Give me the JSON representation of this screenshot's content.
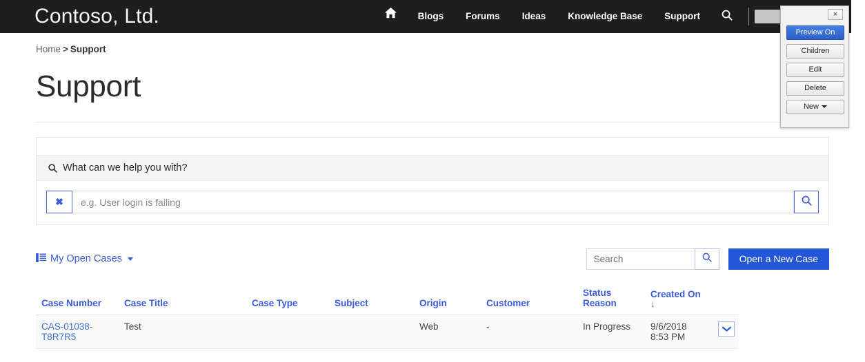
{
  "navbar": {
    "brand": "Contoso, Ltd.",
    "home_icon": "home-icon",
    "links": [
      "Blogs",
      "Forums",
      "Ideas",
      "Knowledge Base",
      "Support"
    ],
    "search_icon": "search-icon",
    "user_label": "",
    "user_caret": "chevron-down-icon"
  },
  "edit_panel": {
    "close_label": "×",
    "buttons": [
      {
        "label": "Preview On",
        "active": true,
        "caret": false
      },
      {
        "label": "Children",
        "active": false,
        "caret": false
      },
      {
        "label": "Edit",
        "active": false,
        "caret": false
      },
      {
        "label": "Delete",
        "active": false,
        "caret": false
      },
      {
        "label": "New",
        "active": false,
        "caret": true
      }
    ]
  },
  "breadcrumb": {
    "home": "Home",
    "separator": ">",
    "current": "Support"
  },
  "page": {
    "title": "Support"
  },
  "help_search": {
    "heading": "What can we help you with?",
    "heading_icon": "search-icon",
    "clear_label": "✖",
    "input_value": "",
    "input_placeholder": "e.g. User login is failing",
    "submit_icon": "search-icon"
  },
  "toolbar": {
    "view_icon": "list-icon",
    "view_label": "My Open Cases",
    "view_caret": "caret-down-icon",
    "search_value": "",
    "search_placeholder": "Search",
    "search_icon": "search-icon",
    "new_case_label": "Open a New Case"
  },
  "grid": {
    "columns": [
      {
        "label": "Case Number",
        "sorted": false
      },
      {
        "label": "Case Title",
        "sorted": false
      },
      {
        "label": "Case Type",
        "sorted": false
      },
      {
        "label": "Subject",
        "sorted": false
      },
      {
        "label": "Origin",
        "sorted": false
      },
      {
        "label": "Customer",
        "sorted": false
      },
      {
        "label": "Status Reason",
        "sorted": false
      },
      {
        "label": "Created On",
        "sorted": true,
        "sort_arrow": "↓"
      }
    ],
    "rows": [
      {
        "case_number": "CAS-01038-T8R7R5",
        "case_title": "Test",
        "case_type": "",
        "subject": "",
        "origin": "Web",
        "customer": "-",
        "status_reason": "In Progress",
        "created_on": "9/6/2018 8:53 PM",
        "action_icon": "chevron-down-icon"
      }
    ]
  },
  "colors": {
    "navbar_bg": "#1d1d1d",
    "accent_blue": "#3b5bdb",
    "primary_button": "#2356d6",
    "link_blue": "#3b6fd4",
    "panel_active": "#2f5fc8"
  }
}
